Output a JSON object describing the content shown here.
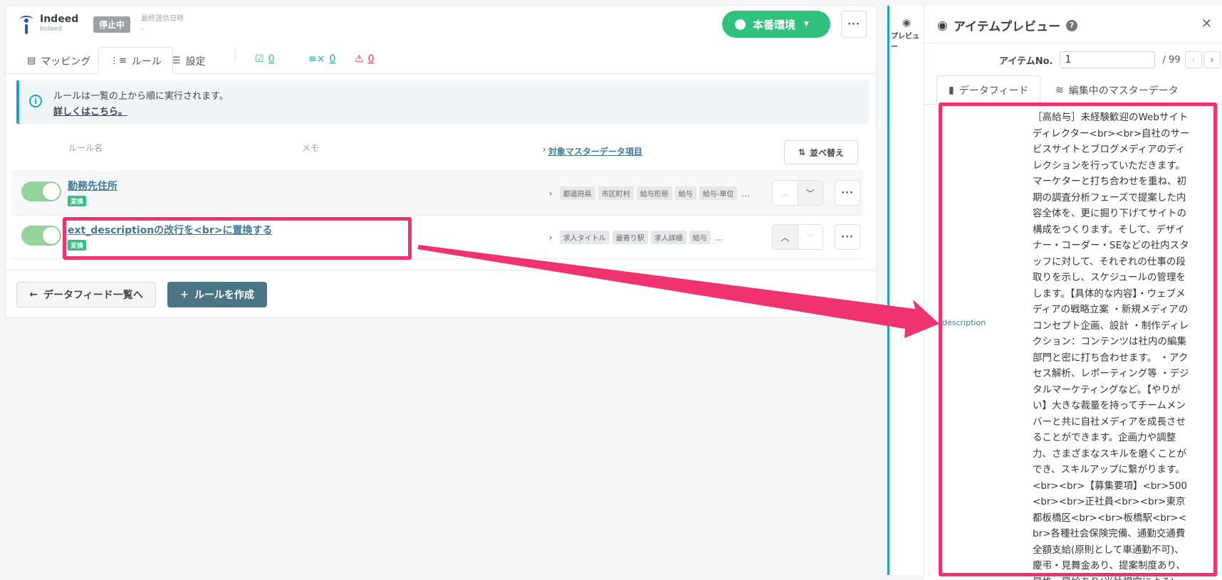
{
  "header": {
    "brand_name": "Indeed",
    "brand_sub": "Indeed",
    "status_badge": "停止中",
    "last_sent_label": "最終送信日時",
    "last_sent_value": "-",
    "env_label": "本番環境",
    "more": "···"
  },
  "tabs": [
    {
      "label": "マッピング",
      "icon": "mapping-icon"
    },
    {
      "label": "ルール",
      "icon": "rule-icon"
    },
    {
      "label": "設定",
      "icon": "settings-icon"
    }
  ],
  "counters": {
    "ok": "0",
    "skip": "0",
    "warn": "0"
  },
  "info": {
    "text": "ルールは一覧の上から順に実行されます。",
    "link": "詳しくはこちら。"
  },
  "table": {
    "col_name": "ルール名",
    "col_memo": "メモ",
    "col_target": "対象マスターデータ項目",
    "sort_label": "並べ替え"
  },
  "rules": [
    {
      "name": "勤務先住所",
      "tag": "変換",
      "fields": [
        "都道府県",
        "市区町村",
        "給与形態",
        "給与",
        "給与-単位"
      ],
      "more_fields": "..."
    },
    {
      "name": "ext_descriptionの改行を<br>に置換する",
      "tag": "変換",
      "fields": [
        "求人タイトル",
        "最寄り駅",
        "求人詳細",
        "給与"
      ],
      "more_fields": "..."
    }
  ],
  "footer": {
    "back_label": "データフィード一覧へ",
    "create_label": "ルールを作成"
  },
  "preview": {
    "side_tab": "プレビュー",
    "title": "アイテムプレビュー",
    "item_no_label": "アイテムNo.",
    "item_no_value": "1",
    "item_total": "/ 99",
    "tab_feed": "データフィード",
    "tab_master": "編集中のマスターデータ",
    "desc_key": "description",
    "desc_value": "［高給与］未経験歓迎のWebサイトディレクター<br><br>自社のサービスサイトとブログメディアのディレクションを行っていただきます。マーケターと打ち合わせを重ね、初期の調査分析フェーズで提案した内容全体を、更に掘り下げてサイトの構成をつくります。そして、デザイナー・コーダー・SEなどの社内スタッフに対して、それぞれの仕事の段取りを示し、スケジュールの管理をします。【具体的な内容】・ウェブメディアの戦略立案 ・新規メディアのコンセプト企画、設計 ・制作ディレクション：コンテンツは社内の編集部門と密に打ち合わせます。 ・アクセス解析、レポーティング等 ・デジタルマーケティングなど。【やりがい】大きな裁量を持ってチームメンバーと共に自社メディアを成長させることができます。企画力や調整力、さまざまなスキルを磨くことができ、スキルアップに繋がります。<br><br>【募集要項】<br>500<br><br>正社員<br><br>東京都板橋区<br><br>板橋駅<br><br>各種社会保険完備、通勤交通費全額支給(原則として車通勤不可)、慶弔・見舞金あり、提案制度あり、昇格・昇給あり(当社規定による)"
  },
  "colors": {
    "accent": "#2ec27e",
    "highlight": "#f0336e",
    "link": "#3b7a9a",
    "info": "#1ba3c6"
  }
}
